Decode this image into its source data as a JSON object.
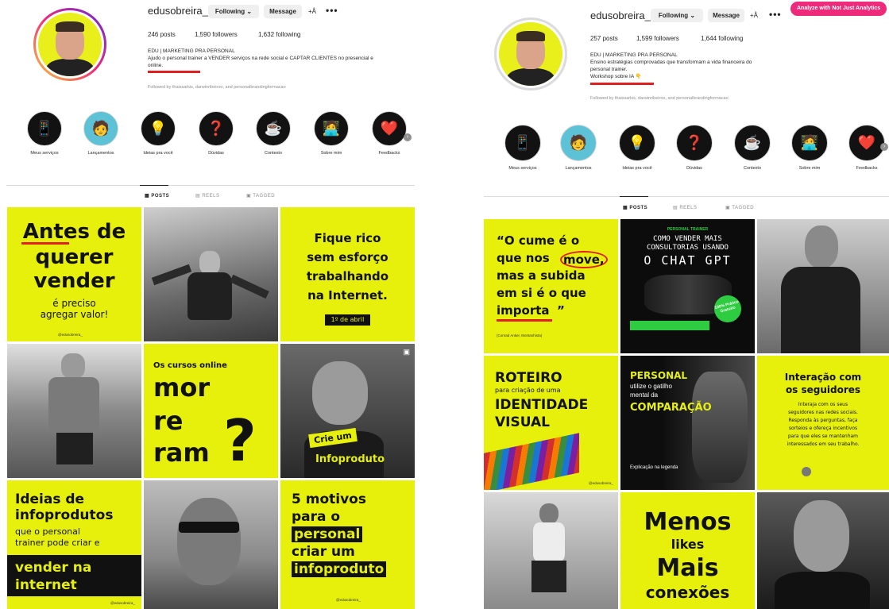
{
  "left": {
    "username": "edusobreira_",
    "following_btn": "Following",
    "message_btn": "Message",
    "add_icon": "+Å",
    "more": "•••",
    "posts": "246 posts",
    "followers": "1,590 followers",
    "following": "1,632 following",
    "bio_title": "EDU | MARKETING PRA PERSONAL",
    "bio_line1": "Ajudo o personal trainer a VENDER serviços na rede social e CAPTAR CLIENTES no presencial e",
    "bio_line2": "online.",
    "followed_by": "Followed by thaissarkis, darwinribeiroo, and personalbrandingformacao",
    "highlights": [
      "Meus serviços",
      "Lançamentos",
      "Ideias pra você",
      "Dúvidas",
      "Contexto",
      "Sobre mim",
      "Feedbacks"
    ],
    "tabs": [
      "POSTS",
      "REELS",
      "TAGGED"
    ],
    "tiles": {
      "t1_a": "Antes de",
      "t1_b": "querer",
      "t1_c": "vender",
      "t1_d": "é preciso",
      "t1_e": "agregar valor!",
      "t1_f": "@edusobreira_",
      "t3_a": "Fique rico",
      "t3_b": "sem esforço",
      "t3_c": "trabalhando",
      "t3_d": "na Internet.",
      "t3_e": "1º de abril",
      "t5_a": "Os cursos online",
      "t5_b": "mor",
      "t5_c": "re",
      "t5_d": "ram",
      "t5_e": "?",
      "t6_a": "Crie um",
      "t6_b": "Infoproduto",
      "t7_a": "Ideias de",
      "t7_b": "infoprodutos",
      "t7_c": "que o personal",
      "t7_d": "trainer pode criar e",
      "t7_e": "vender na",
      "t7_f": "internet",
      "t7_g": "@edusobreira_",
      "t9_a": "5 motivos",
      "t9_b": "para o",
      "t9_c": "personal",
      "t9_d": "criar um",
      "t9_e": "infoproduto",
      "t9_f": "@edusobreira_"
    }
  },
  "right": {
    "username": "edusobreira_",
    "following_btn": "Following",
    "message_btn": "Message",
    "add_icon": "+Å",
    "more": "•••",
    "analyze_btn": "Analyze with Not Just Analytics",
    "posts": "257 posts",
    "followers": "1,599 followers",
    "following": "1,644 following",
    "bio_title": "EDU | MARKETING PRA PERSONAL",
    "bio_line1": "Ensino estratégias comprovadas que transformam a vida financeira do",
    "bio_line2": "personal trainer.",
    "bio_line3": "Workshop sobre IA 👇",
    "followed_by": "Followed by thaissarkis, darwinribeiroo, and personalbrandingformacao",
    "highlights": [
      "Meus serviços",
      "Lançamentos",
      "Ideias pra você",
      "Dúvidas",
      "Contexto",
      "Sobre mim",
      "Feedbacks"
    ],
    "tabs": [
      "POSTS",
      "REELS",
      "TAGGED"
    ],
    "tiles": {
      "t1_a": "“O cume é o",
      "t1_b": "que nos",
      "t1_c": "move,",
      "t1_d": "mas a subida",
      "t1_e": "em si é o que",
      "t1_f": "importa",
      "t1_g": "”",
      "t1_h": "(Conrad Anker, Montanhista)",
      "t2_a": "PERSONAL TRAINER",
      "t2_b": "COMO VENDER MAIS",
      "t2_c": "CONSULTORIAS USANDO",
      "t2_d": "O CHAT GPT",
      "t2_e": "100% Prático Gratuito",
      "t4_a": "ROTEIRO",
      "t4_b": "para criação de uma",
      "t4_c": "IDENTIDADE",
      "t4_d": "VISUAL",
      "t4_e": "@edusobreira_",
      "t5_a": "PERSONAL",
      "t5_b": "utilize o gatilho",
      "t5_c": "mental da",
      "t5_d": "COMPARAÇÃO",
      "t5_e": "Explicação na legenda",
      "t6_a": "Interação com",
      "t6_b": "os seguidores",
      "t6_c": "Interaja com os seus",
      "t6_d": "seguidores nas redes sociais.",
      "t6_e": "Responda às perguntas, faça",
      "t6_f": "sorteios e ofereça incentivos",
      "t6_g": "para que eles se mantenham",
      "t6_h": "interessados em seu trabalho.",
      "t8_a": "Menos",
      "t8_b": "likes",
      "t8_c": "Mais",
      "t8_d": "conexões"
    }
  }
}
